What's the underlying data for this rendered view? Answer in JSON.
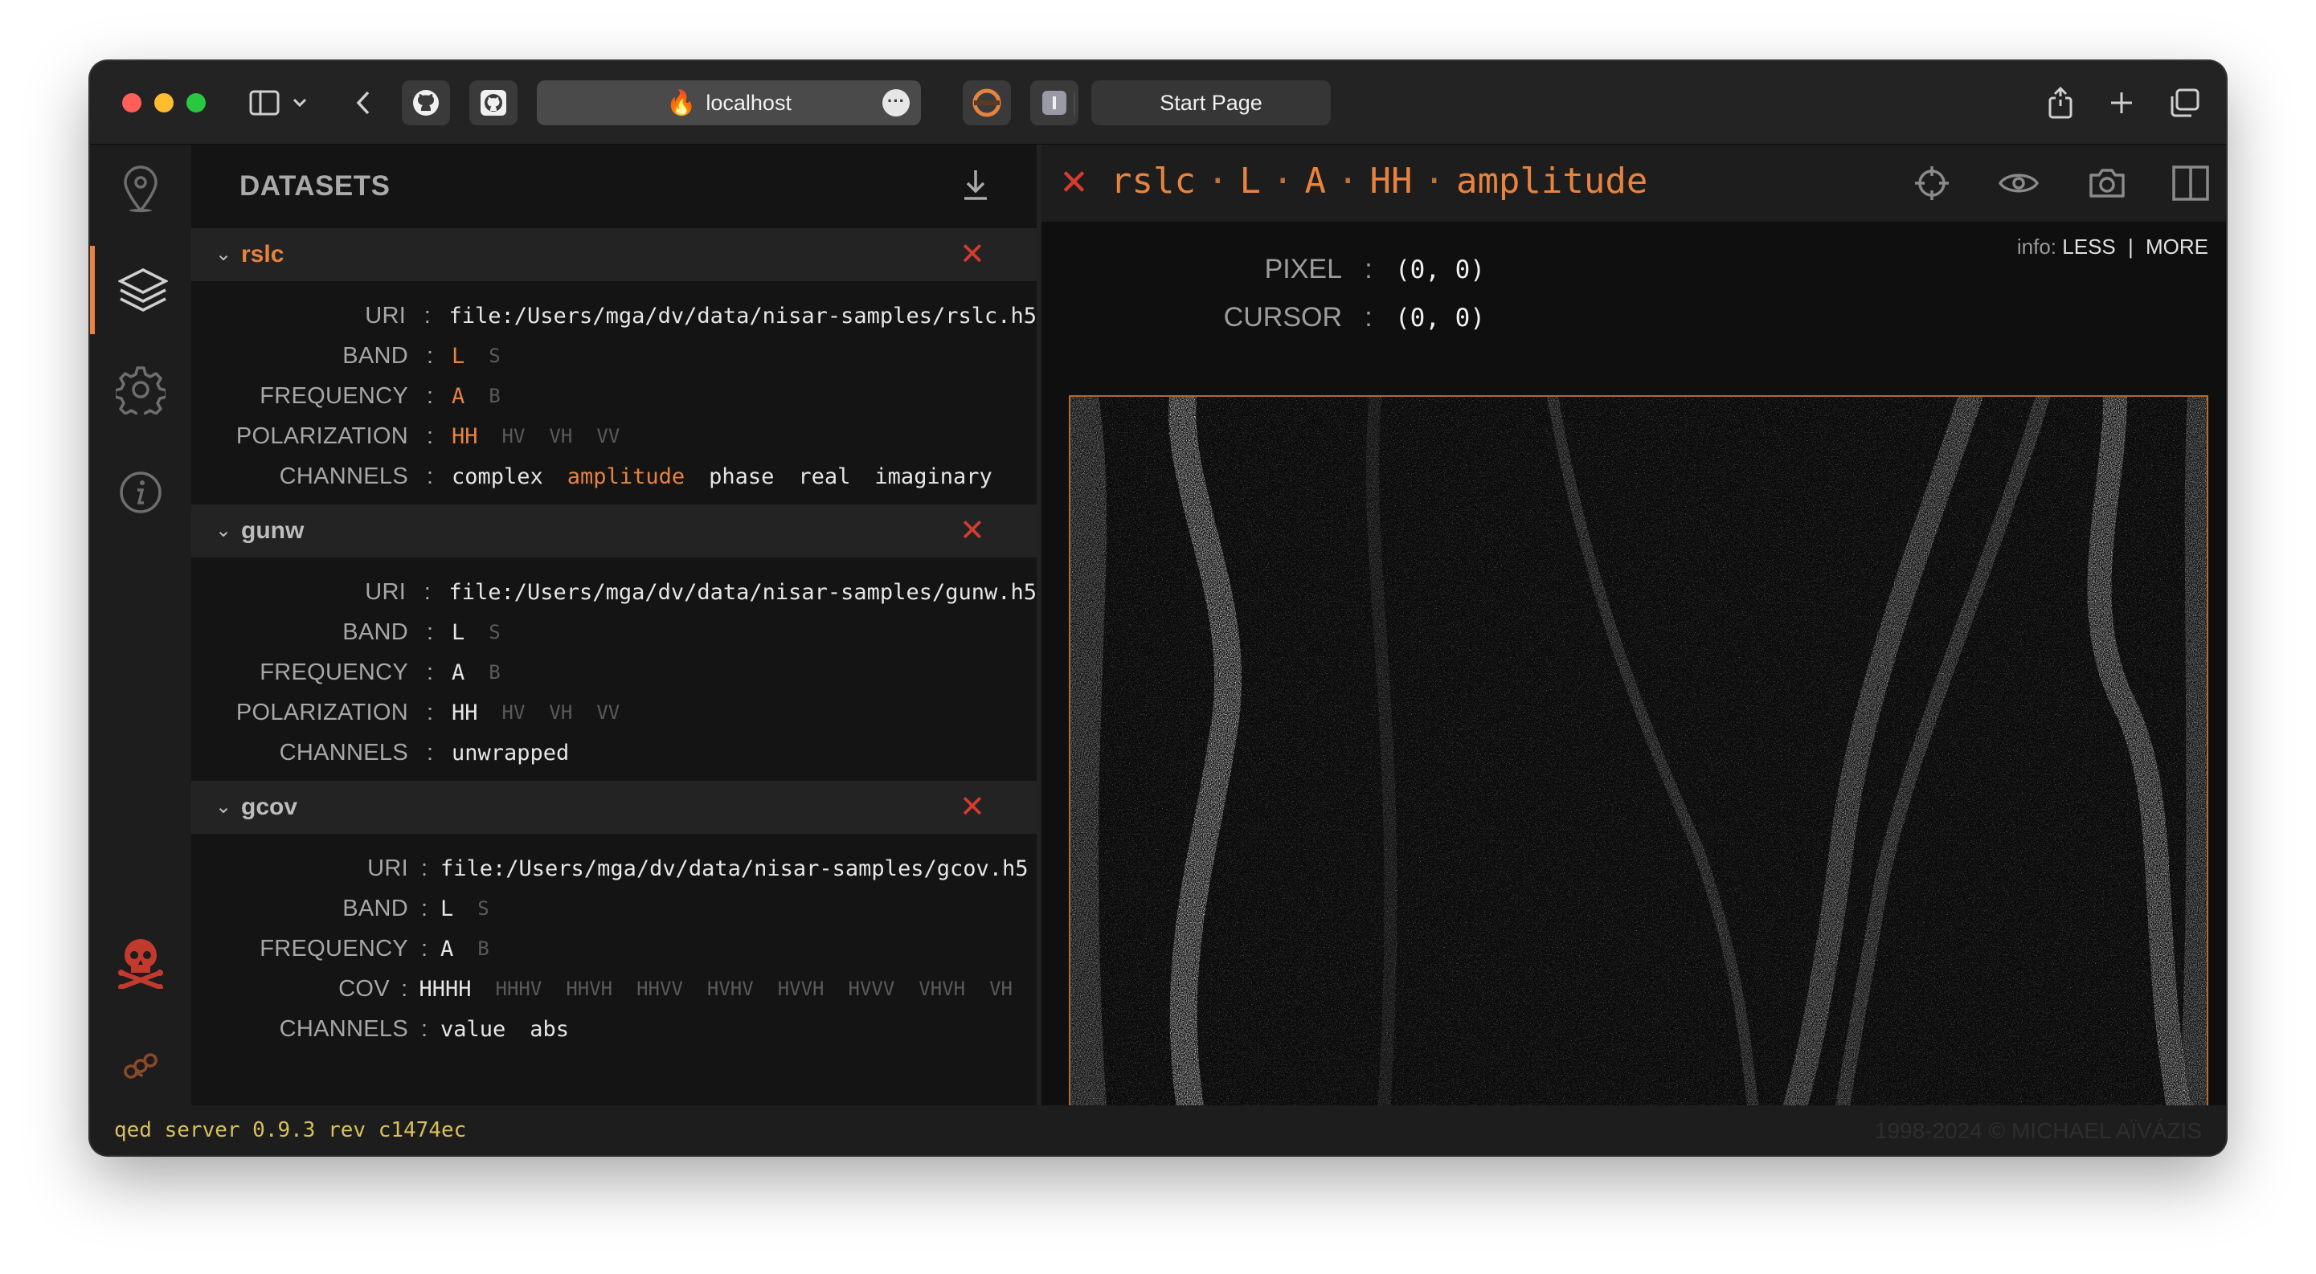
{
  "browser": {
    "address": "localhost",
    "tab_title": "Start Page"
  },
  "panel": {
    "title": "DATASETS"
  },
  "datasets": [
    {
      "name": "rslc",
      "uri_label": "URI",
      "uri": "file:/Users/mga/dv/data/nisar-samples/rslc.h5",
      "band_label": "BAND",
      "bands": [
        "L",
        "S"
      ],
      "frequency_label": "FREQUENCY",
      "frequencies": [
        "A",
        "B"
      ],
      "polarization_label": "POLARIZATION",
      "polarizations": [
        "HH",
        "HV",
        "VH",
        "VV"
      ],
      "channels_label": "CHANNELS",
      "channels": [
        "complex",
        "amplitude",
        "phase",
        "real",
        "imaginary"
      ]
    },
    {
      "name": "gunw",
      "uri_label": "URI",
      "uri": "file:/Users/mga/dv/data/nisar-samples/gunw.h5",
      "band_label": "BAND",
      "bands": [
        "L",
        "S"
      ],
      "frequency_label": "FREQUENCY",
      "frequencies": [
        "A",
        "B"
      ],
      "polarization_label": "POLARIZATION",
      "polarizations": [
        "HH",
        "HV",
        "VH",
        "VV"
      ],
      "channels_label": "CHANNELS",
      "channels": [
        "unwrapped"
      ]
    },
    {
      "name": "gcov",
      "uri_label": "URI",
      "uri": "file:/Users/mga/dv/data/nisar-samples/gcov.h5",
      "band_label": "BAND",
      "bands": [
        "L",
        "S"
      ],
      "frequency_label": "FREQUENCY",
      "frequencies": [
        "A",
        "B"
      ],
      "cov_label": "COV",
      "covs": [
        "HHHH",
        "HHHV",
        "HHVH",
        "HHVV",
        "HVHV",
        "HVVH",
        "HVVV",
        "VHVH",
        "VH"
      ],
      "channels_label": "CHANNELS",
      "channels": [
        "value",
        "abs"
      ]
    }
  ],
  "viewer": {
    "crumbs": [
      "rslc",
      "L",
      "A",
      "HH",
      "amplitude"
    ],
    "separator": "·",
    "info_prefix": "info:",
    "info_less": "LESS",
    "info_bar": "|",
    "info_more": "MORE",
    "pixel_label": "PIXEL",
    "pixel_value": "(0, 0)",
    "cursor_label": "CURSOR",
    "cursor_value": "(0, 0)",
    "image_alt": "SAR amplitude image"
  },
  "status": {
    "left": "qed server 0.9.3 rev c1474ec",
    "right": "1998-2024 © MICHAEL AÏVÁZIS"
  },
  "colors": {
    "accent": "#e7833f",
    "close": "#d63b2f",
    "status_text": "#d8c15a"
  }
}
